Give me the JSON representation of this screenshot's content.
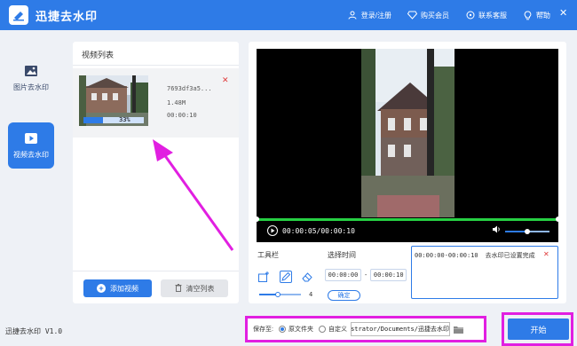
{
  "app": {
    "title": "迅捷去水印",
    "version": "迅捷去水印 V1.0"
  },
  "topbar": {
    "actions": [
      {
        "label": "登录/注册",
        "icon": "user-icon"
      },
      {
        "label": "购买会员",
        "icon": "diamond-icon"
      },
      {
        "label": "联系客服",
        "icon": "headset-icon"
      },
      {
        "label": "帮助",
        "icon": "lightbulb-icon"
      }
    ],
    "window_controls": [
      "minimize-icon",
      "close-icon"
    ]
  },
  "sidebar": {
    "items": [
      {
        "label": "图片去水印",
        "icon": "image-icon",
        "active": false
      },
      {
        "label": "视频去水印",
        "icon": "video-icon",
        "active": true
      }
    ]
  },
  "video_list": {
    "title": "视频列表",
    "items": [
      {
        "name": "7693df3a5...",
        "size": "1.48M",
        "duration": "00:00:10",
        "progress": 0.33,
        "progress_label": "33%"
      }
    ],
    "add_label": "添加视频",
    "clear_label": "清空列表"
  },
  "player": {
    "time": "00:00:05/00:00:10",
    "playback_fraction": 0.5,
    "volume": 0.5
  },
  "tools": {
    "title": "工具栏",
    "icons": [
      "select-rect-icon",
      "pen-icon",
      "eraser-icon"
    ],
    "brush_size": "4",
    "brush_fraction": 0.45
  },
  "time_select": {
    "title": "选择时间",
    "start": "00:00:00",
    "sep": "-",
    "end": "00:00:10",
    "confirm_label": "确定"
  },
  "log": {
    "entries": [
      {
        "time": "00:00:00-00:00:10",
        "status": "去水印已设置完成"
      }
    ]
  },
  "bottom": {
    "save_label": "保存至:",
    "options": [
      {
        "label": "原文件夹",
        "selected": true
      },
      {
        "label": "自定义",
        "selected": false
      }
    ],
    "path": "C:/Users/Administrator/Documents/迅捷去水印",
    "start_label": "开始"
  },
  "colors": {
    "brand": "#2e7be7",
    "annotation": "#e11fe1",
    "seekbar": "#26d043",
    "danger": "#e03a3a"
  }
}
